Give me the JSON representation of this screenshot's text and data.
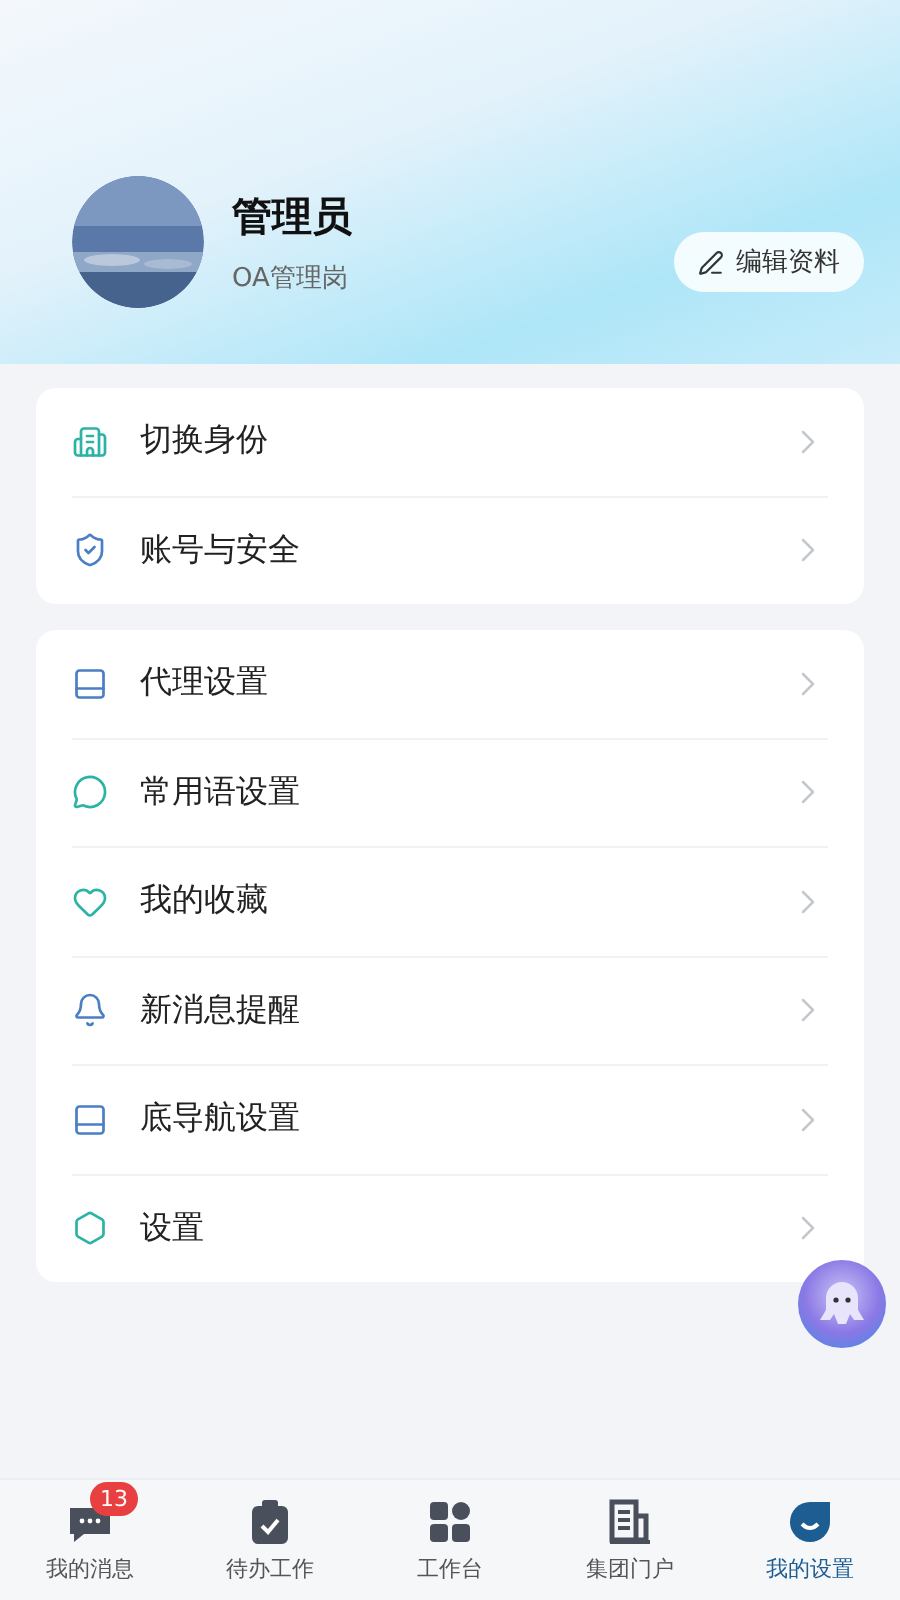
{
  "profile": {
    "name": "管理员",
    "role": "OA管理岗",
    "edit_button": "编辑资料"
  },
  "groups": [
    {
      "items": [
        {
          "kind": "identity",
          "label": "切换身份"
        },
        {
          "kind": "security",
          "label": "账号与安全"
        }
      ]
    },
    {
      "items": [
        {
          "kind": "panel",
          "label": "代理设置"
        },
        {
          "kind": "chat",
          "label": "常用语设置"
        },
        {
          "kind": "heart",
          "label": "我的收藏"
        },
        {
          "kind": "bell",
          "label": "新消息提醒"
        },
        {
          "kind": "panel",
          "label": "底导航设置"
        },
        {
          "kind": "gear",
          "label": "设置"
        }
      ]
    }
  ],
  "tabs": [
    {
      "kind": "messages",
      "label": "我的消息",
      "badge": "13",
      "selected": false
    },
    {
      "kind": "todo",
      "label": "待办工作",
      "selected": false
    },
    {
      "kind": "workbench",
      "label": "工作台",
      "selected": false
    },
    {
      "kind": "portal",
      "label": "集团门户",
      "selected": false
    },
    {
      "kind": "me",
      "label": "我的设置",
      "selected": true
    }
  ]
}
